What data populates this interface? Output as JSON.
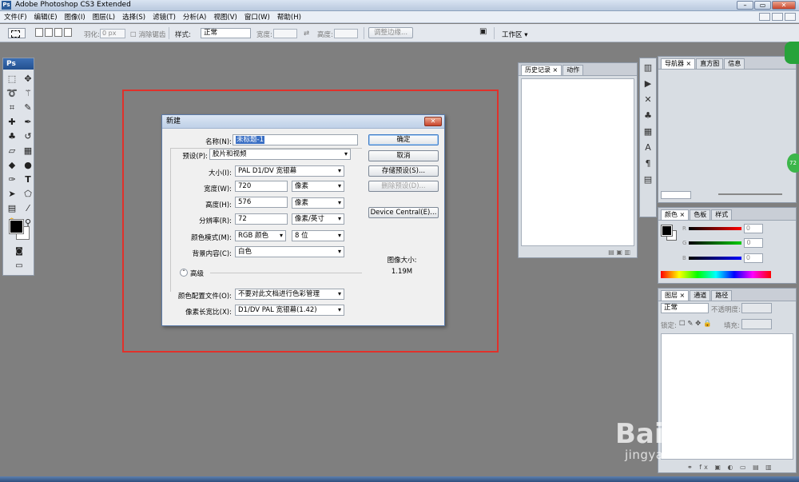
{
  "window": {
    "title": "Adobe Photoshop CS3 Extended",
    "logo": "Ps"
  },
  "menu": [
    "文件(F)",
    "编辑(E)",
    "图像(I)",
    "图层(L)",
    "选择(S)",
    "滤镜(T)",
    "分析(A)",
    "视图(V)",
    "窗口(W)",
    "帮助(H)"
  ],
  "options": {
    "feather_label": "羽化:",
    "feather_value": "0 px",
    "antialias_label": "消除锯齿",
    "style_label": "样式:",
    "style_value": "正常",
    "width_label": "宽度:",
    "height_label": "高度:",
    "refine_edge": "调整边缘...",
    "workspace": "工作区 ▾"
  },
  "toolbox": {
    "logo": "Ps"
  },
  "dialog": {
    "title": "新建",
    "name_label": "名称(N):",
    "name_value": "未标题-1",
    "preset_label": "预设(P):",
    "preset_value": "胶片和视频",
    "size_label": "大小(I):",
    "size_value": "PAL D1/DV 宽银幕",
    "width_label": "宽度(W):",
    "width_value": "720",
    "width_unit": "像素",
    "height_label": "高度(H):",
    "height_value": "576",
    "height_unit": "像素",
    "resolution_label": "分辨率(R):",
    "resolution_value": "72",
    "resolution_unit": "像素/英寸",
    "mode_label": "颜色模式(M):",
    "mode_value": "RGB 颜色",
    "depth_value": "8 位",
    "bg_label": "背景内容(C):",
    "bg_value": "白色",
    "advanced_label": "高级",
    "profile_label": "颜色配置文件(O):",
    "profile_value": "不要对此文档进行色彩管理",
    "aspect_label": "像素长宽比(X):",
    "aspect_value": "D1/DV PAL 宽银幕(1.42)",
    "ok": "确定",
    "cancel": "取消",
    "save_preset": "存储预设(S)...",
    "delete_preset": "删除预设(D)...",
    "device_central": "Device Central(E)...",
    "image_size_label": "图像大小:",
    "image_size_value": "1.19M"
  },
  "history_panel": {
    "tab1": "历史记录 ×",
    "tab2": "动作"
  },
  "navigator_panel": {
    "tab1": "导航器 ×",
    "tab2": "直方图",
    "tab3": "信息"
  },
  "color_panel": {
    "tab1": "颜色 ×",
    "tab2": "色板",
    "tab3": "样式",
    "r_label": "R",
    "g_label": "G",
    "b_label": "B",
    "r_value": "0",
    "g_value": "0",
    "b_value": "0"
  },
  "layers_panel": {
    "tab1": "图层 ×",
    "tab2": "通道",
    "tab3": "路径",
    "blend_mode": "正常",
    "opacity_label": "不透明度:",
    "lock_label": "锁定:",
    "fill_label": "填充:"
  },
  "watermark": {
    "brand": "Bai度经验",
    "url": "jingyan.baidu.com"
  },
  "badge": "72"
}
